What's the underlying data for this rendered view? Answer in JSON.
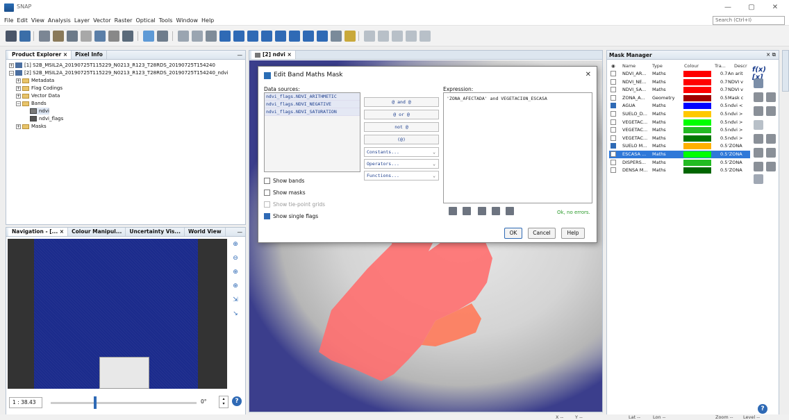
{
  "window": {
    "title": "SNAP",
    "controls": [
      "—",
      "▢",
      "✕"
    ]
  },
  "menubar": [
    "File",
    "Edit",
    "View",
    "Analysis",
    "Layer",
    "Vector",
    "Raster",
    "Optical",
    "Tools",
    "Window",
    "Help"
  ],
  "search": {
    "placeholder": "Search (Ctrl+I)"
  },
  "product_explorer": {
    "tabs": [
      "Product Explorer",
      "Pixel Info"
    ],
    "products": [
      "[1] S2B_MSIL2A_20190725T115229_N0213_R123_T28RDS_20190725T154240",
      "[2] S2B_MSIL2A_20190725T115229_N0213_R123_T28RDS_20190725T154240_ndvi"
    ],
    "nodes": {
      "metadata": "Metadata",
      "flag_codings": "Flag Codings",
      "vector_data": "Vector Data",
      "bands": "Bands",
      "band_ndvi": "ndvi",
      "band_flags": "ndvi_flags",
      "masks": "Masks"
    }
  },
  "navigation": {
    "tabs": [
      "Navigation - [...",
      "Colour Manipul...",
      "Uncertainty Vis...",
      "World View"
    ],
    "scale": "1 : 38.43",
    "angle": "0°"
  },
  "image_view": {
    "tab": "[2] ndvi"
  },
  "dialog": {
    "title": "Edit Band Maths Mask",
    "data_sources_label": "Data sources:",
    "data_sources": [
      "ndvi_flags.NDVI_ARITHMETIC",
      "ndvi_flags.NDVI_NEGATIVE",
      "ndvi_flags.NDVI_SATURATION"
    ],
    "operators": [
      "@ and @",
      "@ or @",
      "not @",
      "(@)"
    ],
    "dropdowns": [
      "Constants...",
      "Operators...",
      "Functions..."
    ],
    "checkboxes": {
      "show_bands": "Show bands",
      "show_masks": "Show masks",
      "show_tie_point": "Show tie-point grids",
      "show_single_flags": "Show single flags"
    },
    "expression_label": "Expression:",
    "expression": "'ZONA_AFECTADA' and VEGETACION_ESCASA",
    "status": "Ok, no errors.",
    "buttons": {
      "ok": "OK",
      "cancel": "Cancel",
      "help": "Help"
    }
  },
  "mask_manager": {
    "title": "Mask Manager",
    "columns": [
      "Name",
      "Type",
      "Colour",
      "Tra...",
      "Descr"
    ],
    "rows": [
      {
        "name": "NDVI_AR...",
        "type": "Maths",
        "colour": "#ff0000",
        "trans": "0.7",
        "desc": "An arit",
        "checked": false,
        "selected": false
      },
      {
        "name": "NDVI_NE...",
        "type": "Maths",
        "colour": "#ff0000",
        "trans": "0.7",
        "desc": "NDVI v",
        "checked": false,
        "selected": false
      },
      {
        "name": "NDVI_SA...",
        "type": "Maths",
        "colour": "#ff0000",
        "trans": "0.7",
        "desc": "NDVI v",
        "checked": false,
        "selected": false
      },
      {
        "name": "ZONA_A...",
        "type": "Geometry",
        "colour": "#a00000",
        "trans": "0.5",
        "desc": "Mask c",
        "checked": false,
        "selected": false
      },
      {
        "name": "AGUA",
        "type": "Maths",
        "colour": "#0000ff",
        "trans": "0.5",
        "desc": "ndvi <",
        "checked": true,
        "selected": false
      },
      {
        "name": "SUELO_D...",
        "type": "Maths",
        "colour": "#ffc800",
        "trans": "0.5",
        "desc": "ndvi >",
        "checked": false,
        "selected": false
      },
      {
        "name": "VEGETAC...",
        "type": "Maths",
        "colour": "#00ff00",
        "trans": "0.5",
        "desc": "ndvi >",
        "checked": false,
        "selected": false
      },
      {
        "name": "VEGETAC...",
        "type": "Maths",
        "colour": "#22bb22",
        "trans": "0.5",
        "desc": "ndvi >",
        "checked": false,
        "selected": false
      },
      {
        "name": "VEGETAC...",
        "type": "Maths",
        "colour": "#007700",
        "trans": "0.5",
        "desc": "ndvi >",
        "checked": false,
        "selected": false
      },
      {
        "name": "SUELO M...",
        "type": "Maths",
        "colour": "#ffb000",
        "trans": "0.5",
        "desc": "'ZONA",
        "checked": true,
        "selected": false
      },
      {
        "name": "ESCASA ...",
        "type": "Maths",
        "colour": "#00ff00",
        "trans": "0.5",
        "desc": "'ZONA",
        "checked": false,
        "selected": true
      },
      {
        "name": "DISPERS...",
        "type": "Maths",
        "colour": "#22bb22",
        "trans": "0.5",
        "desc": "'ZONA",
        "checked": false,
        "selected": false
      },
      {
        "name": "DENSA M...",
        "type": "Maths",
        "colour": "#006600",
        "trans": "0.5",
        "desc": "'ZONA",
        "checked": false,
        "selected": false
      }
    ],
    "fx_label": "f(x) [x]",
    "side_tab": "Mask Manager"
  },
  "statusbar": {
    "x": "X",
    "x_val": "--",
    "y": "Y",
    "y_val": "--",
    "lat": "Lat",
    "lat_val": "--",
    "lon": "Lon",
    "lon_val": "--",
    "zoom": "Zoom --",
    "level": "Level --"
  }
}
